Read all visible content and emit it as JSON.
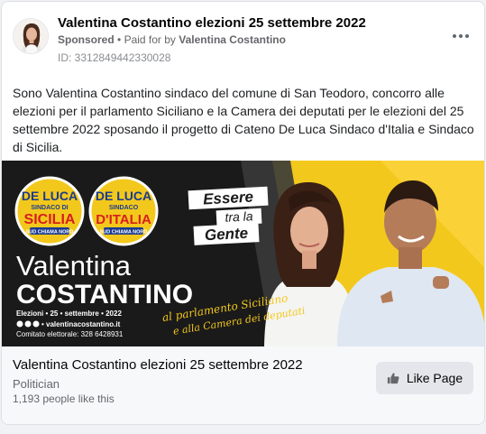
{
  "post": {
    "page_name": "Valentina Costantino elezioni 25 settembre 2022",
    "sponsored_label": "Sponsored",
    "separator": "•",
    "paid_for_prefix": "Paid for by",
    "paid_for_by": "Valentina Costantino",
    "library_id": "ID: 3312849442330028",
    "body": "Sono Valentina Costantino sindaco del comune di San Teodoro, concorro alle elezioni per il parlamento Siciliano e la Camera dei deputati per le elezioni del 25 settembre 2022 sposando il progetto di Cateno De Luca Sindaco d'Italia e Sindaco di Sicilia."
  },
  "creative": {
    "logo_sicilia": {
      "line1": "DE LUCA",
      "line2": "SINDACO DI",
      "line3": "SICILIA",
      "tag": "SUD CHIAMA NORD"
    },
    "logo_italia": {
      "line1": "DE LUCA",
      "line2": "SINDACO",
      "line3": "D'ITALIA",
      "tag": "SUD CHIAMA NORD"
    },
    "first_name": "Valentina",
    "last_name": "COSTANTINO",
    "election_line": "Elezioni • 25 • settembre • 2022",
    "website": "• valentinacostantino.it",
    "committee": "Comitato elettorale: 328 6428931",
    "slogan_1": "Essere",
    "slogan_2": "tra la",
    "slogan_3": "Gente",
    "script_1": "al parlamento Siciliano",
    "script_2": "e alla Camera dei deputati",
    "colors": {
      "dark": "#1a1a1a",
      "yellow": "#f3c81c",
      "red": "#d81e1e",
      "blue": "#1a3b8f"
    }
  },
  "footer": {
    "page_title": "Valentina Costantino elezioni 25 settembre 2022",
    "category": "Politician",
    "likes": "1,193 people like this",
    "like_button": "Like Page",
    "like_icon": "thumbs-up-icon"
  },
  "icons": {
    "more": "more-horizontal-icon"
  }
}
